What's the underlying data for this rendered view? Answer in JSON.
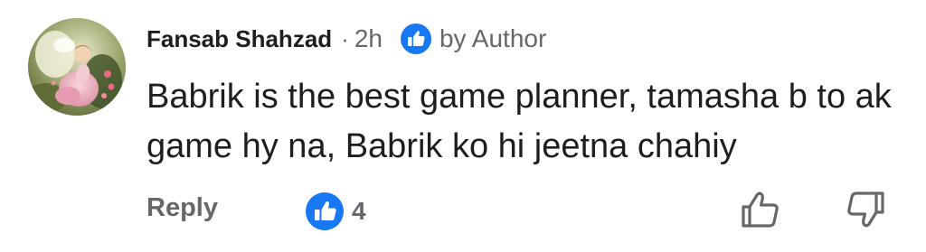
{
  "comment": {
    "avatar_icon": "avatar-fairy-illustration",
    "author_name": "Fansab Shahzad",
    "separator": "·",
    "time_ago": "2h",
    "author_badge": {
      "icon": "thumbs-up-badge-icon",
      "label": "by Author"
    },
    "text": "Babrik is the best game planner, tamasha b to ak game hy na, Babrik ko hi jeetna chahiy"
  },
  "actions": {
    "reply_label": "Reply",
    "reaction_icon": "thumbs-up-reaction-icon",
    "reaction_count": "4",
    "like_icon": "thumbs-up-outline-icon",
    "dislike_icon": "thumbs-down-outline-icon"
  },
  "colors": {
    "primary_text": "#1c1e21",
    "secondary_text": "#65676b",
    "facebook_blue": "#1877f2"
  }
}
